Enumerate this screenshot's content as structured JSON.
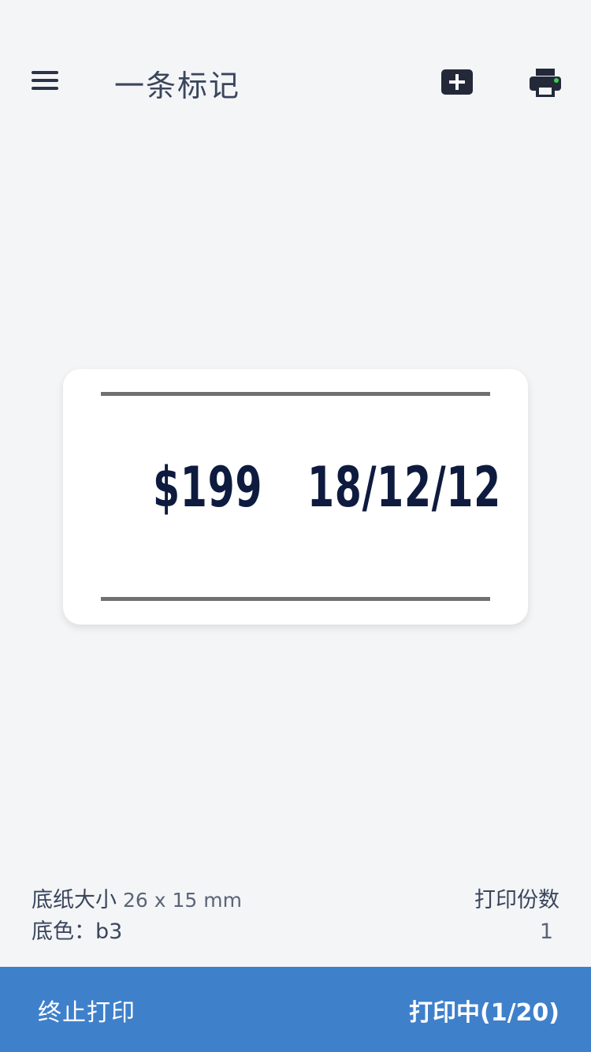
{
  "header": {
    "title": "一条标记",
    "menu_icon": "menu-icon",
    "add_icon": "add-box-icon",
    "printer_icon": "printer-icon",
    "printer_status_color": "#3ccf4e"
  },
  "label": {
    "price": "$199",
    "date": "18/12/12"
  },
  "info": {
    "paper_size_label": "底纸大小",
    "paper_size_value": "26 x 15 mm",
    "color_label": "底色：",
    "color_value": "b3",
    "copies_label": "打印份数",
    "copies_value": "1"
  },
  "bottom_bar": {
    "stop_label": "终止打印",
    "status_label": "打印中(1/20)",
    "bar_color": "#3f80cb"
  }
}
